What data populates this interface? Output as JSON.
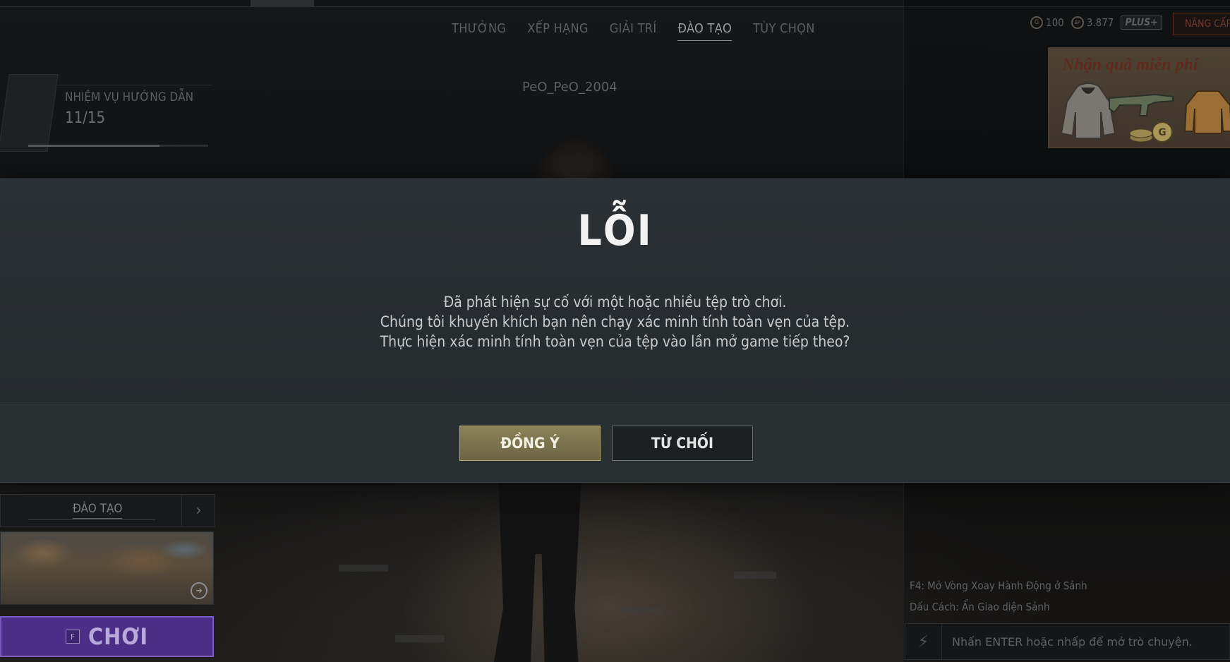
{
  "nav": {
    "tabs": [
      {
        "label": "THƯỞNG",
        "active": false
      },
      {
        "label": "XẾP HẠNG",
        "active": false
      },
      {
        "label": "GIẢI TRÍ",
        "active": false
      },
      {
        "label": "ĐÀO TẠO",
        "active": true
      },
      {
        "label": "TÙY CHỌN",
        "active": false
      }
    ]
  },
  "currency": {
    "g_coin_icon": "G",
    "g_coin": "100",
    "bp_icon": "BP",
    "bp": "3.877",
    "plus_label": "PLUS+",
    "upgrade_label": "NÂNG CẤP"
  },
  "promo": {
    "text": "Nhận quà miễn phí"
  },
  "mission": {
    "title": "NHIỆM VỤ HƯỚNG DẪN",
    "count": "11/15",
    "progress": 0.73
  },
  "player": {
    "name": "PeO_PeO_2004"
  },
  "dialog": {
    "title": "LỖI",
    "lines": [
      "Đã phát hiện sự cố với một hoặc nhiều tệp trò chơi.",
      "Chúng tôi khuyến khích bạn nên chạy xác minh tính toàn vẹn của tệp.",
      "Thực hiện xác minh tính toàn vẹn của tệp vào lần mở game tiếp theo?"
    ],
    "agree_label": "ĐỒNG Ý",
    "refuse_label": "TỪ CHỐI"
  },
  "mode": {
    "label": "ĐÀO TẠO",
    "play_key": "F",
    "play_label": "CHƠI"
  },
  "hints": {
    "h1": "F4: Mở Vòng Xoay Hành Động ở Sảnh",
    "h2": "Dấu Cách: Ẩn Giao diện Sảnh"
  },
  "chat": {
    "placeholder": "Nhấn ENTER hoặc nhấp để mở trò chuyện."
  },
  "colors": {
    "accent_gold": "#8c8259",
    "play_purple": "#4b2f86",
    "dialog_bg": "#252a2d"
  }
}
